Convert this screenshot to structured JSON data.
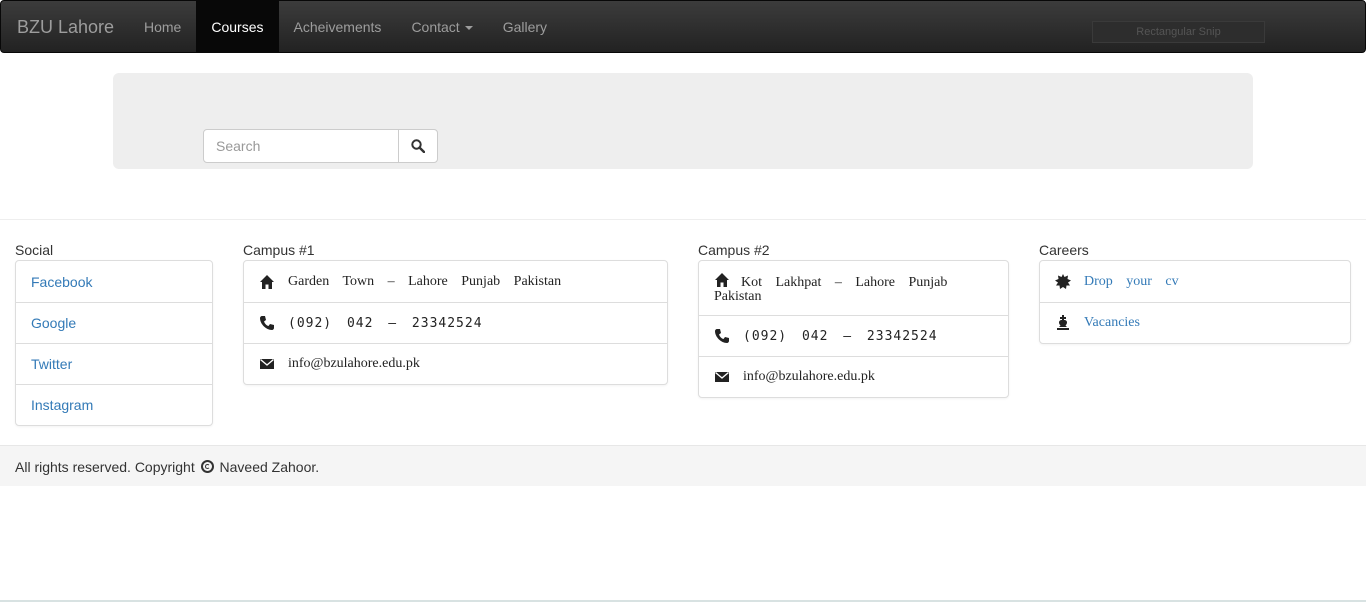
{
  "navbar": {
    "brand": "BZU Lahore",
    "items": [
      {
        "label": "Home",
        "active": false
      },
      {
        "label": "Courses",
        "active": true
      },
      {
        "label": "Acheivements",
        "active": false
      },
      {
        "label": "Contact",
        "active": false,
        "dropdown": true
      },
      {
        "label": "Gallery",
        "active": false
      }
    ],
    "snip_label": "Rectangular Snip"
  },
  "search": {
    "placeholder": "Search",
    "value": "",
    "button_icon": "search-icon"
  },
  "social": {
    "title": "Social",
    "links": [
      "Facebook",
      "Google",
      "Twitter",
      "Instagram"
    ]
  },
  "campus1": {
    "title": "Campus #1",
    "address": "Garden Town – Lahore Punjab Pakistan",
    "phone": "(092) 042 – 23342524",
    "email": "info@bzulahore.edu.pk"
  },
  "campus2": {
    "title": "Campus #2",
    "address": "Kot Lakhpat – Lahore Punjab Pakistan",
    "phone": "(092) 042 – 23342524",
    "email": "info@bzulahore.edu.pk"
  },
  "careers": {
    "title": "Careers",
    "items": [
      "Drop your cv",
      "Vacancies"
    ]
  },
  "footer": {
    "text_before": "All rights reserved. Copyright",
    "text_after": "Naveed Zahoor."
  },
  "colors": {
    "link": "#337ab7",
    "navbar": "#222222",
    "jumbotron": "#eeeeee"
  }
}
